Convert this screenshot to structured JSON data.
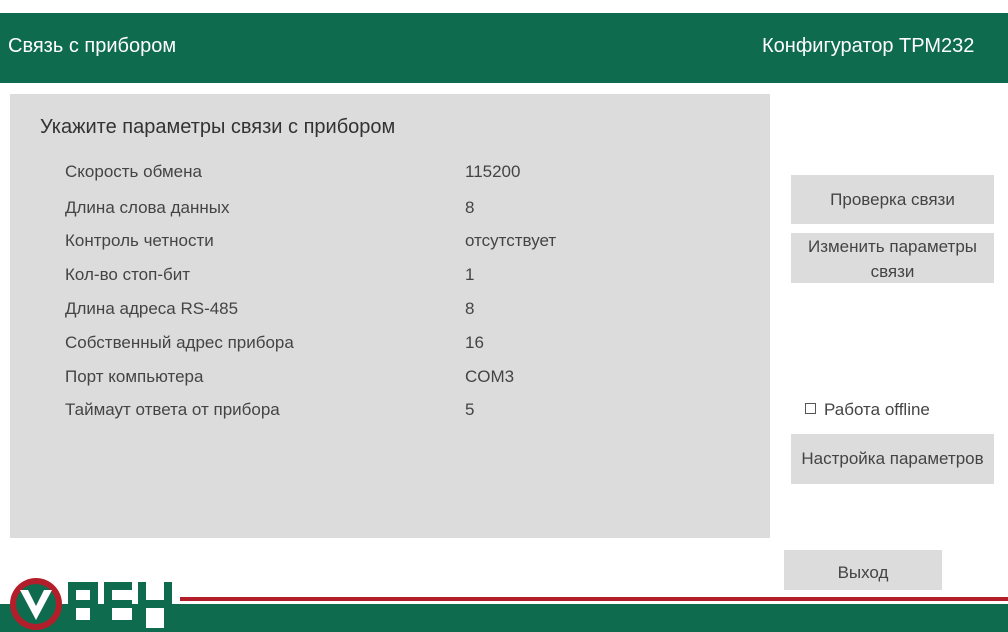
{
  "header": {
    "title": "Связь с прибором",
    "app_name": "Конфигуратор ТРМ232"
  },
  "panel": {
    "heading": "Укажите параметры связи с прибором",
    "params": [
      {
        "label": "Скорость обмена",
        "value": "115200"
      },
      {
        "label": "Длина слова данных",
        "value": "8"
      },
      {
        "label": "Контроль четности",
        "value": "отсутствует"
      },
      {
        "label": "Кол-во стоп-бит",
        "value": "1"
      },
      {
        "label": "Длина адреса RS-485",
        "value": "8"
      },
      {
        "label": "Собственный адрес прибора",
        "value": "16"
      },
      {
        "label": "Порт компьютера",
        "value": "COM3"
      },
      {
        "label": "Таймаут ответа от прибора",
        "value": "5"
      }
    ]
  },
  "buttons": {
    "check": "Проверка связи",
    "change_line1": "Изменить параметры",
    "change_line2": "связи",
    "settings": "Настройка параметров",
    "exit": "Выход"
  },
  "offline": {
    "label": "Работа offline",
    "checked": false
  },
  "logo": {
    "text": "ОВЕН"
  },
  "colors": {
    "brand_green": "#0f6b4e",
    "brand_red": "#b21f2b",
    "panel_gray": "#dcdcdc"
  }
}
